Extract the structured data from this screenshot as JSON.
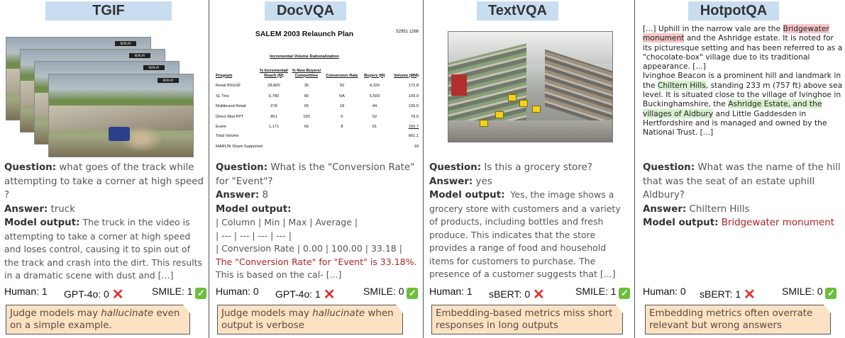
{
  "columns": [
    {
      "dataset": "TGIF",
      "question_label": "Question:",
      "question": "what goes of the track while attempting to take a corner at high speed ?",
      "answer_label": "Answer:",
      "answer": "truck",
      "model_output_label": "Model output:",
      "model_output": "The truck in the video is attempting to take a corner at high speed and loses control, causing it to spin out of the track and crash into the dirt. This results in a dramatic scene with dust and [...]",
      "frame_badge": "REPLAY",
      "scores": {
        "human": "Human: 1",
        "judge": "GPT-4o: 0",
        "smile": "SMILE: 1"
      },
      "note_prefix": "Judge models may ",
      "note_em": "hallucinate",
      "note_suffix": " even on a simple example."
    },
    {
      "dataset": "DocVQA",
      "question_label": "Question:",
      "question": "What is the \"Conversion Rate\" for \"Event\"?",
      "answer_label": "Answer:",
      "answer": "8",
      "model_output_label": "Model output:",
      "model_output_lines": [
        "| Column | Min | Max | Average |",
        "| --- | --- | --- | --- |",
        "| Conversion Rate | 0.00 | 100.00 | 33.18 |"
      ],
      "model_output_red": "The \"Conversion Rate\" for \"Event\" is 33.18%",
      "model_output_tail": ". This is based on the cal- [...]",
      "doc": {
        "title": "SALEM 2003 Relaunch Plan",
        "number": "52951 1266",
        "subtitle": "Incremental Volume Rationalization",
        "headers": [
          "Program",
          "% Incremental/ Reach (M)",
          "% New Buyers/ Competitive",
          "Conversion Rate",
          "Buyers (M)",
          "Volume (MM)"
        ],
        "rows": [
          [
            "Retail BSGSF",
            "28,800",
            "30",
            "50",
            "4,320",
            "172.8"
          ],
          [
            "SL Tins",
            "6,780",
            "80",
            "NA",
            "5,500",
            "109.9"
          ],
          [
            "Multibrand Retail",
            "278",
            "65",
            "18",
            "44",
            "136.6"
          ],
          [
            "Direct Mail PPT",
            "861",
            "100",
            "6",
            "52",
            "79.5"
          ],
          [
            "Event",
            "1,171",
            "65",
            "8",
            "61",
            "150.7"
          ]
        ],
        "total_label": "Total Volume",
        "total_value": "661.1",
        "share_label": "MARLIN Share Supported",
        "share_value": ".18"
      },
      "scores": {
        "human": "Human: 0",
        "judge": "GPT-4o: 1",
        "smile": "SMILE: 0"
      },
      "note_prefix": "Judge models may ",
      "note_em": "hallucinate",
      "note_suffix": " when output is verbose"
    },
    {
      "dataset": "TextVQA",
      "question_label": "Question:",
      "question": "Is this a grocery store?",
      "answer_label": "Answer:",
      "answer": "yes",
      "model_output_label": "Model output:",
      "model_output": "Yes, the image shows a grocery store with customers and a variety of products, including bottles and fresh produce. This indicates that the store provides a range of food and household items for customers to purchase. The presence of a customer suggests that [...]",
      "scores": {
        "human": "Human: 1",
        "judge": "sBERT: 0",
        "smile": "SMILE: 1"
      },
      "note": "Embedding-based metrics miss short responses in long outputs"
    },
    {
      "dataset": "HotpotQA",
      "passage": {
        "p1_a": "[...] Uphill in the narrow vale are the ",
        "p1_hl": "Bridgewater monument",
        "p1_b": " and the Ashridge estate. It is noted for its picturesque setting and has been referred to as a \"chocolate-box\" village due to its traditional appearance. [...]",
        "p2_a": "Ivinghoe Beacon is a prominent hill and landmark in the ",
        "p2_hl1": "Chiltern Hills",
        "p2_b": ", standing 233 m (757 ft) above sea level. It is situated close to the village of Ivinghoe in Buckinghamshire, the ",
        "p2_hl2": "Ashridge Estate, and the villages of Aldbury",
        "p2_c": " and Little Gaddesden in Hertfordshire and is managed and owned by the National Trust. [...]"
      },
      "question_label": "Question:",
      "question": "What was the name of the hill that was the seat of an estate uphill Aldbury?",
      "answer_label": "Answer:",
      "answer": "Chiltern Hills",
      "model_output_label": "Model output:",
      "model_output": "Bridgewater monument",
      "scores": {
        "human": "Human: 0",
        "judge": "sBERT: 1",
        "smile": "SMILE: 0"
      },
      "note": "Embedding metrics often overrate relevant but wrong answers"
    }
  ],
  "icons": {
    "wrong": "cross-mark-icon",
    "right": "check-mark-icon"
  },
  "colors": {
    "banner": "#c9ddf0",
    "note": "#fbe2c4",
    "wrong_output": "#b02424",
    "cross": "#e03030",
    "check": "#6abf3a"
  }
}
